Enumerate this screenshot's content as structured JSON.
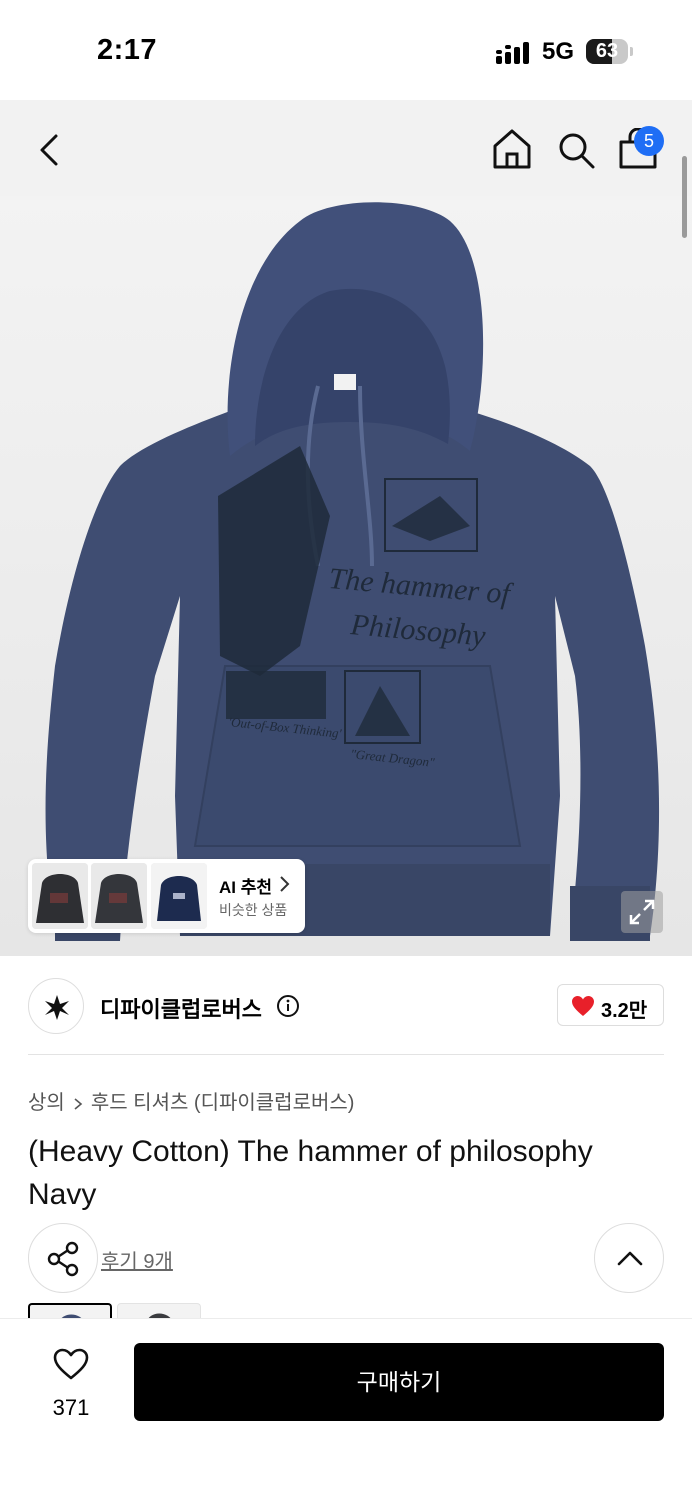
{
  "status_bar": {
    "time": "2:17",
    "network": "5G",
    "battery": "63",
    "battery_level": 0.63
  },
  "header": {
    "back_icon": "chevron-left-icon",
    "home_icon": "home-icon",
    "search_icon": "search-icon",
    "cart_icon": "shopping-bag-icon",
    "cart_badge": "5",
    "badge_color": "#1f6ef5"
  },
  "hero": {
    "print_title_line1": "The hammer of",
    "print_title_line2": "Philosophy",
    "print_caption_left": "'Out-of-Box Thinking'",
    "print_caption_right": "\"Great Dragon\"",
    "hoodie_color": "#3e4c70"
  },
  "ai_recommend": {
    "title": "AI 추천",
    "subtitle": "비슷한 상품"
  },
  "brand": {
    "name": "디파이클럽로버스",
    "likes": "3.2만",
    "heart_color": "#e8202a"
  },
  "breadcrumb": {
    "category": "상의",
    "subcategory": "후드 티셔츠 (디파이클럽로버스)"
  },
  "product": {
    "title": "(Heavy Cotton) The hammer of philosophy Navy",
    "reviews_label": "후기 9개"
  },
  "bottom_bar": {
    "wish_count": "371",
    "buy_label": "구매하기"
  }
}
